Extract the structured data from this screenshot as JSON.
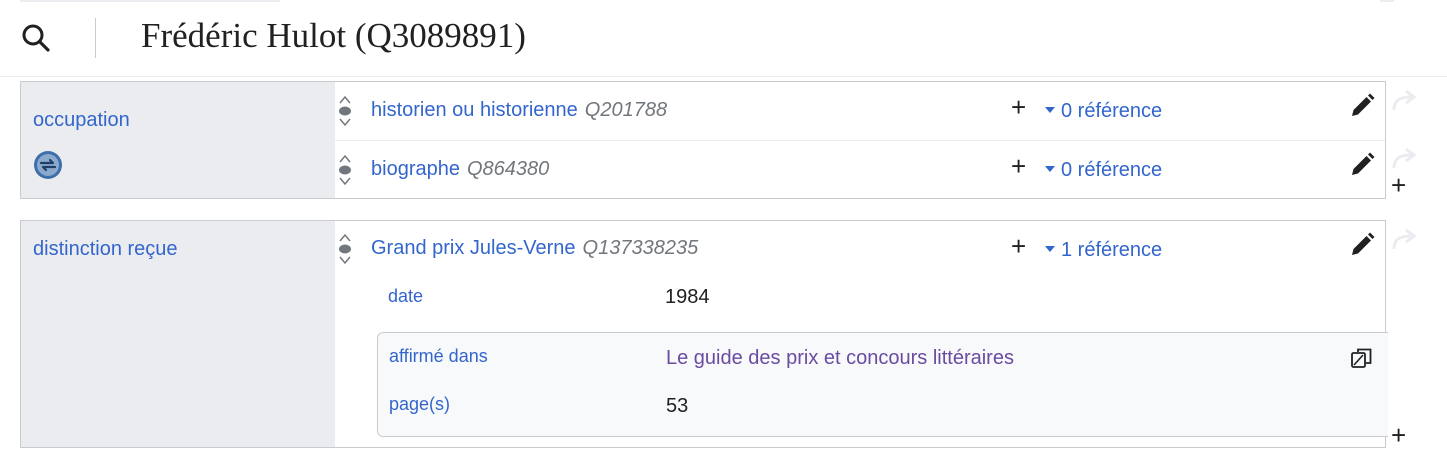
{
  "header": {
    "title": "Frédéric Hulot (Q3089891)"
  },
  "icons": {
    "search": "search-icon",
    "property": "sync-icon",
    "rank": "rank-normal-icon",
    "edit": "pencil-icon",
    "share": "share-arrow-icon",
    "copy": "copy-icon"
  },
  "colors": {
    "link": "#3366cc",
    "visited_link": "#6b4ba1",
    "qid": "#72777d",
    "property_bg": "#eaecf0"
  },
  "statement_groups": [
    {
      "property": "occupation",
      "statements": [
        {
          "value": "historien ou historienne",
          "qid": "Q201788",
          "add": "+",
          "references": "0 référence"
        },
        {
          "value": "biographe",
          "qid": "Q864380",
          "add": "+",
          "references": "0 référence"
        }
      ]
    },
    {
      "property": "distinction reçue",
      "statements": [
        {
          "value": "Grand prix Jules-Verne",
          "qid": "Q137338235",
          "add": "+",
          "references": "1 référence",
          "qualifiers": [
            {
              "label": "date",
              "value": "1984"
            }
          ],
          "reference": [
            {
              "label": "affirmé dans",
              "value": "Le guide des prix et concours littéraires"
            },
            {
              "label": "page(s)",
              "value": "53"
            }
          ]
        }
      ]
    }
  ],
  "add_statement": "+"
}
